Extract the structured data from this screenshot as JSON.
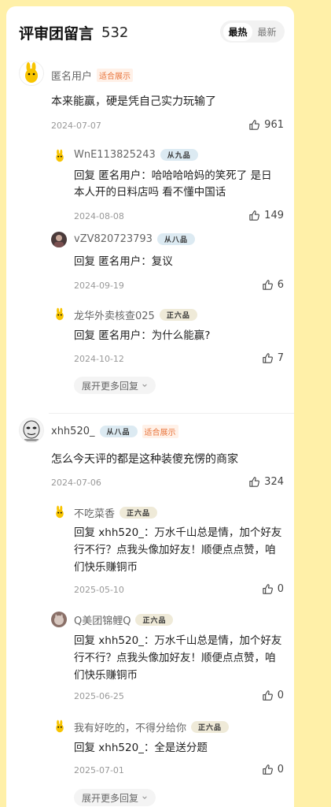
{
  "header": {
    "title": "评审团留言",
    "count": "532",
    "sort_hot": "最热",
    "sort_new": "最新"
  },
  "comments": [
    {
      "user": "匿名用户",
      "fit_badge": "适合展示",
      "text": "本来能赢，硬是凭自己实力玩输了",
      "date": "2024-07-07",
      "likes": "961",
      "replies": [
        {
          "user": "WnE113825243",
          "rank": "从九品",
          "text": "回复  匿名用户：哈哈哈哈妈的笑死了 是日本人开的日料店吗 看不懂中国话",
          "date": "2024-08-08",
          "likes": "149"
        },
        {
          "user": "vZV820723793",
          "rank": "从八品",
          "text": "回复  匿名用户：复议",
          "date": "2024-09-19",
          "likes": "6"
        },
        {
          "user": "龙华外卖核查025",
          "rank": "正六品",
          "text": "回复  匿名用户：为什么能赢?",
          "date": "2024-10-12",
          "likes": "7"
        }
      ],
      "expand_label": "展开更多回复"
    },
    {
      "user": "xhh520_",
      "rank": "从八品",
      "fit_badge": "适合展示",
      "text": "怎么今天评的都是这种装傻充愣的商家",
      "date": "2024-07-06",
      "likes": "324",
      "replies": [
        {
          "user": "不吃菜香",
          "rank": "正六品",
          "text": "回复  xhh520_：万水千山总是情，加个好友行不行？点我头像加好友！顺便点点赞，咱们快乐赚铜币",
          "date": "2025-05-10",
          "likes": "0"
        },
        {
          "user": "Q美团锦鲤Q",
          "rank": "正六品",
          "text": "回复  xhh520_：万水千山总是情，加个好友行不行？点我头像加好友！顺便点点赞，咱们快乐赚铜币",
          "date": "2025-06-25",
          "likes": "0"
        },
        {
          "user": "我有好吃的，不得分给你",
          "rank": "正六品",
          "text": "回复  xhh520_：全是送分题",
          "date": "2025-07-01",
          "likes": "0"
        }
      ],
      "expand_label": "展开更多回复"
    }
  ],
  "colors": {
    "background": "#FFF0A8",
    "accent_badge": "#E8743B"
  },
  "icons": {
    "like": "thumbs-up-icon",
    "expand": "chevron-down-icon"
  }
}
